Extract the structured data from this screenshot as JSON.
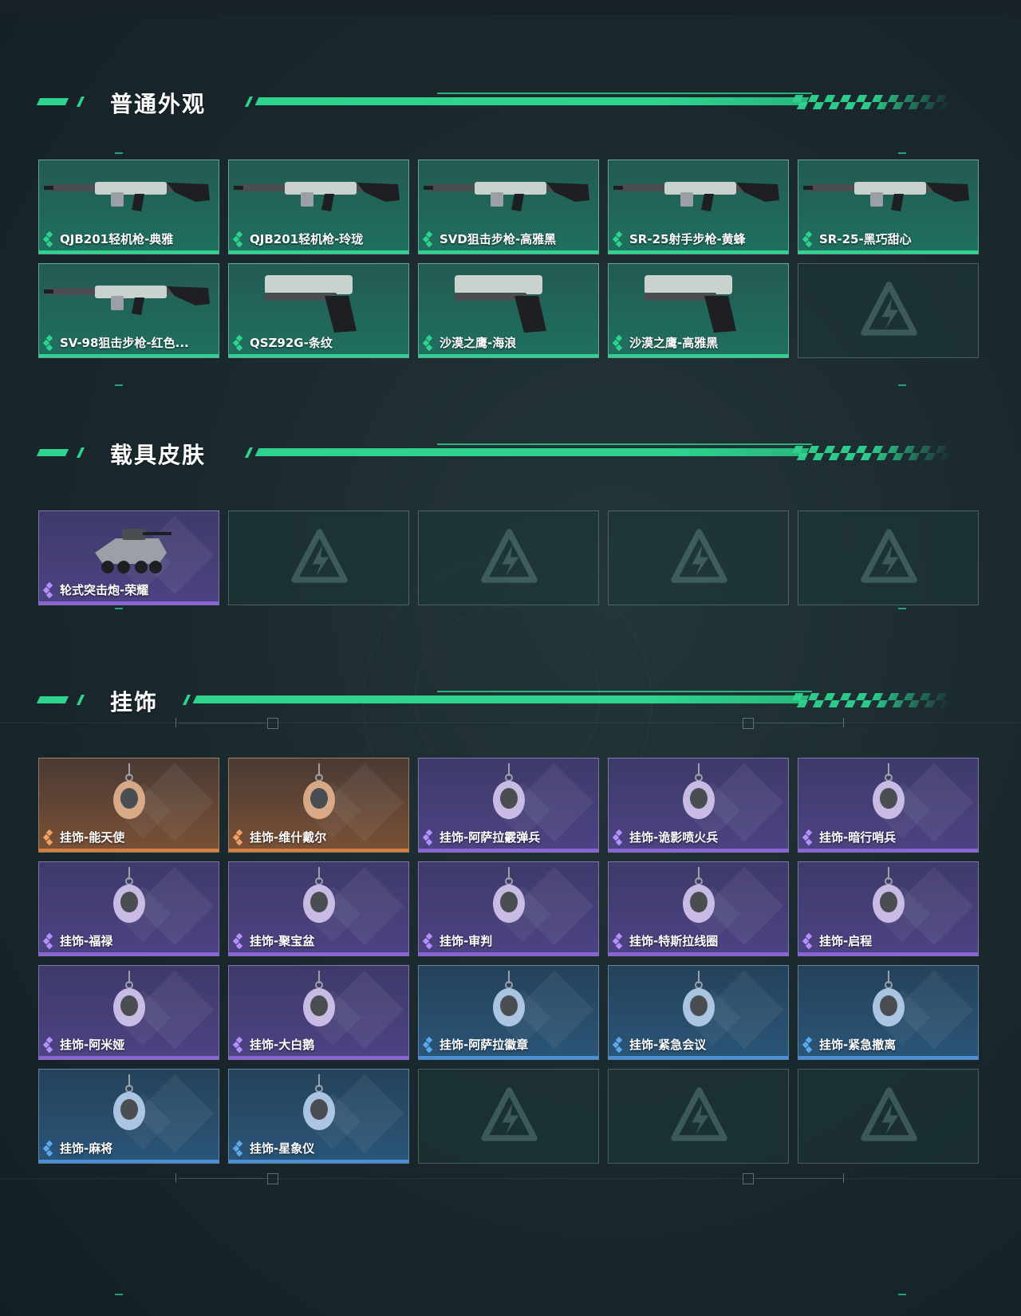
{
  "sections": {
    "skins": {
      "title": "普通外观",
      "items": [
        {
          "label": "QJB201轻机枪-典雅",
          "rarity": "green",
          "icon": "lmg-icon"
        },
        {
          "label": "QJB201轻机枪-玲珑",
          "rarity": "green",
          "icon": "lmg-icon"
        },
        {
          "label": "SVD狙击步枪-高雅黑",
          "rarity": "green",
          "icon": "sniper-rifle-icon"
        },
        {
          "label": "SR-25射手步枪-黄蜂",
          "rarity": "green",
          "icon": "marksman-rifle-icon"
        },
        {
          "label": "SR-25-黑巧甜心",
          "rarity": "green",
          "icon": "marksman-rifle-icon"
        },
        {
          "label": "SV-98狙击步枪-红色...",
          "rarity": "green",
          "icon": "sniper-rifle-icon"
        },
        {
          "label": "QSZ92G-条纹",
          "rarity": "green",
          "icon": "pistol-icon"
        },
        {
          "label": "沙漠之鹰-海浪",
          "rarity": "green",
          "icon": "pistol-icon"
        },
        {
          "label": "沙漠之鹰-高雅黑",
          "rarity": "green",
          "icon": "pistol-icon"
        }
      ],
      "empty_slots": 1
    },
    "vehicles": {
      "title": "载具皮肤",
      "items": [
        {
          "label": "轮式突击炮-荣耀",
          "rarity": "purple",
          "icon": "vehicle-icon"
        }
      ],
      "empty_slots": 4
    },
    "charms": {
      "title": "挂饰",
      "items": [
        {
          "label": "挂饰-能天使",
          "rarity": "orange",
          "icon": "charm-icon"
        },
        {
          "label": "挂饰-维什戴尔",
          "rarity": "orange",
          "icon": "charm-icon"
        },
        {
          "label": "挂饰-阿萨拉霰弹兵",
          "rarity": "purple",
          "icon": "charm-icon"
        },
        {
          "label": "挂饰-诡影喷火兵",
          "rarity": "purple",
          "icon": "charm-icon"
        },
        {
          "label": "挂饰-暗行哨兵",
          "rarity": "purple",
          "icon": "charm-icon"
        },
        {
          "label": "挂饰-福禄",
          "rarity": "purple",
          "icon": "charm-icon"
        },
        {
          "label": "挂饰-聚宝盆",
          "rarity": "purple",
          "icon": "charm-icon"
        },
        {
          "label": "挂饰-审判",
          "rarity": "purple",
          "icon": "charm-icon"
        },
        {
          "label": "挂饰-特斯拉线圈",
          "rarity": "purple",
          "icon": "charm-icon"
        },
        {
          "label": "挂饰-启程",
          "rarity": "purple",
          "icon": "charm-icon"
        },
        {
          "label": "挂饰-阿米娅",
          "rarity": "purple",
          "icon": "charm-icon"
        },
        {
          "label": "挂饰-大白鹅",
          "rarity": "purple",
          "icon": "charm-icon"
        },
        {
          "label": "挂饰-阿萨拉徽章",
          "rarity": "blue",
          "icon": "charm-icon"
        },
        {
          "label": "挂饰-紧急会议",
          "rarity": "blue",
          "icon": "charm-icon"
        },
        {
          "label": "挂饰-紧急撤离",
          "rarity": "blue",
          "icon": "charm-icon"
        },
        {
          "label": "挂饰-麻将",
          "rarity": "blue",
          "icon": "charm-icon"
        },
        {
          "label": "挂饰-星象仪",
          "rarity": "blue",
          "icon": "charm-icon"
        }
      ],
      "empty_slots": 3
    }
  },
  "colors": {
    "accent": "#2ed38e",
    "green": "#2ed38e",
    "purple": "#8a63d8",
    "orange": "#d98040",
    "blue": "#4a90d8"
  }
}
